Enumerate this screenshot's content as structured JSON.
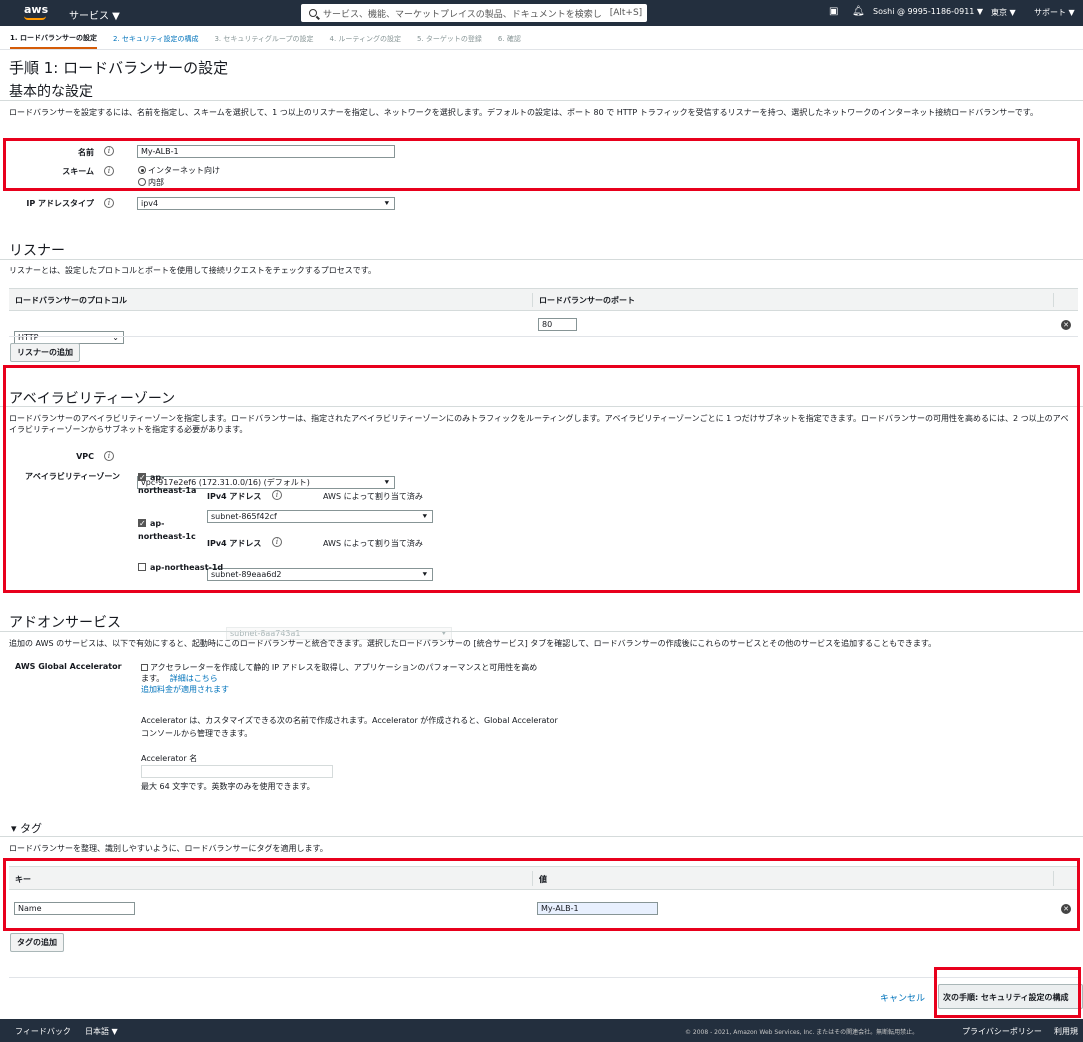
{
  "topnav": {
    "logo": "aws",
    "services": "サービス ▼",
    "search_placeholder": "サービス、機能、マーケットプレイスの製品、ドキュメントを検索し",
    "search_shortcut": "[Alt+S]",
    "user": "Soshi @ 9995-1186-0911 ▼",
    "region": "東京 ▼",
    "support": "サポート ▼"
  },
  "steps": [
    "1. ロードバランサーの設定",
    "2. セキュリティ設定の構成",
    "3. セキュリティグループの設定",
    "4. ルーティングの設定",
    "5. ターゲットの登録",
    "6. 確認"
  ],
  "page_title": "手順 1: ロードバランサーの設定",
  "basic": {
    "title": "基本的な設定",
    "description": "ロードバランサーを設定するには、名前を指定し、スキームを選択して、1 つ以上のリスナーを指定し、ネットワークを選択します。デフォルトの設定は、ポート 80 で HTTP トラフィックを受信するリスナーを持つ、選択したネットワークのインターネット接続ロードバランサーです。",
    "name_label": "名前",
    "name_value": "My-ALB-1",
    "scheme_label": "スキーム",
    "scheme_options": [
      "インターネット向け",
      "内部"
    ],
    "ip_label": "IP アドレスタイプ",
    "ip_value": "ipv4"
  },
  "listener": {
    "title": "リスナー",
    "description": "リスナーとは、設定したプロトコルとポートを使用して接続リクエストをチェックするプロセスです。",
    "col_protocol": "ロードバランサーのプロトコル",
    "col_port": "ロードバランサーのポート",
    "protocol": "HTTP",
    "port": "80",
    "add_button": "リスナーの追加"
  },
  "az": {
    "title": "アベイラビリティーゾーン",
    "description": "ロードバランサーのアベイラビリティーゾーンを指定します。ロードバランサーは、指定されたアベイラビリティーゾーンにのみトラフィックをルーティングします。アベイラビリティーゾーンごとに 1 つだけサブネットを指定できます。ロードバランサーの可用性を高めるには、2 つ以上のアベイラビリティーゾーンからサブネットを指定する必要があります。",
    "vpc_label": "VPC",
    "vpc_value": "vpc-917e2ef6 (172.31.0.0/16) (デフォルト)",
    "az_label": "アベイラビリティーゾーン",
    "zones": [
      {
        "name": "ap-northeast-1a",
        "name_l1": "ap-",
        "name_l2": "northeast-1a",
        "subnet": "subnet-865f42cf",
        "ipv4_label": "IPv4 アドレス",
        "ipv4_value": "AWS によって割り当て済み"
      },
      {
        "name": "ap-northeast-1c",
        "name_l1": "ap-",
        "name_l2": "northeast-1c",
        "subnet": "subnet-89eaa6d2",
        "ipv4_label": "IPv4 アドレス",
        "ipv4_value": "AWS によって割り当て済み"
      },
      {
        "name": "ap-northeast-1d",
        "subnet": "subnet-8aa743a1"
      }
    ]
  },
  "addon": {
    "title": "アドオンサービス",
    "description": "追加の AWS のサービスは、以下で有効にすると、起動時にこのロードバランサーと統合できます。選択したロードバランサーの [統合サービス] タブを確認して、ロードバランサーの作成後にこれらのサービスとその他のサービスを追加することもできます。",
    "ga_label": "AWS Global Accelerator",
    "ga_text_l1": "アクセラレーターを作成して静的 IP アドレスを取得し、アプリケーションのパフォーマンスと可用性を高め",
    "ga_text_l2": "ます。",
    "ga_link1": "詳細はこちら",
    "ga_link2": "追加料金が適用されます",
    "acc_text_l1": "Accelerator は、カスタマイズできる次の名前で作成されます。Accelerator が作成されると、Global Accelerator",
    "acc_text_l2": "コンソールから管理できます。",
    "acc_name_label": "Accelerator 名",
    "acc_hint": "最大 64 文字です。英数字のみを使用できます。"
  },
  "tags": {
    "title": "▾ タグ",
    "description": "ロードバランサーを整理、識別しやすいように、ロードバランサーにタグを適用します。",
    "col_key": "キー",
    "col_value": "値",
    "key": "Name",
    "value": "My-ALB-1",
    "add_button": "タグの追加"
  },
  "actions": {
    "cancel": "キャンセル",
    "next": "次の手順: セキュリティ設定の構成"
  },
  "footer": {
    "feedback": "フィードバック",
    "language": "日本語 ▼",
    "copyright": "© 2008 - 2021, Amazon Web Services, Inc. またはその関連会社。無断転用禁止。",
    "privacy": "プライバシーポリシー",
    "terms": "利用規"
  },
  "colors": {
    "nav": "#232f3e",
    "accent": "#ff9900",
    "highlight": "#e8001c",
    "link": "#0073bb"
  }
}
